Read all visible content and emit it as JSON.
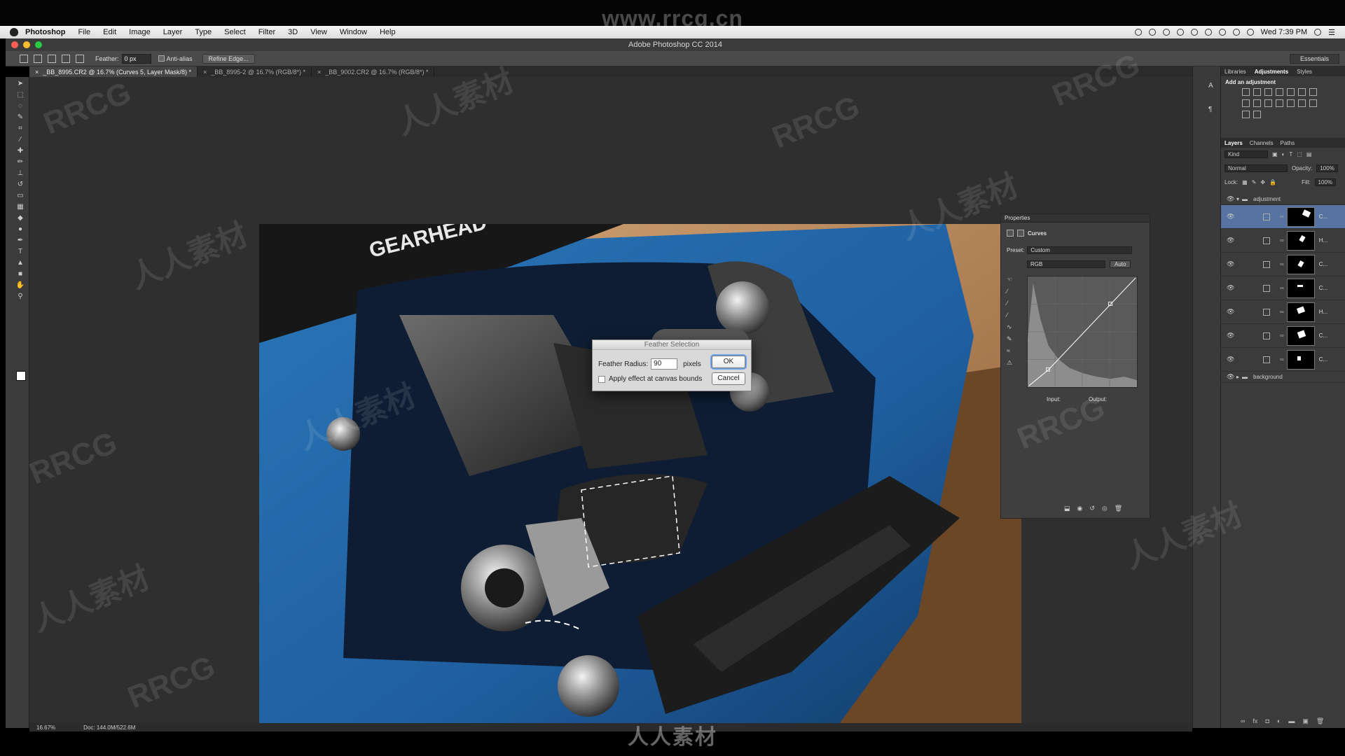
{
  "watermarks": {
    "site_url": "www.rrcg.cn",
    "brand_bottom": "人人素材",
    "tiles": [
      "RRCG",
      "人人素材",
      "RRCG",
      "人人素材",
      "RRCG",
      "人人素材",
      "RRCG",
      "人人素材",
      "RRCG",
      "人人素材",
      "RRCG",
      "人人素材"
    ]
  },
  "menubar": {
    "app_name": "Photoshop",
    "items": [
      "File",
      "Edit",
      "Image",
      "Layer",
      "Type",
      "Select",
      "Filter",
      "3D",
      "View",
      "Window",
      "Help"
    ],
    "clock": "Wed 7:39 PM"
  },
  "window": {
    "title": "Adobe Photoshop CC 2014"
  },
  "options": {
    "feather_label": "Feather:",
    "feather_value": "0 px",
    "antialias_label": "Anti-alias",
    "refine_edge_label": "Refine Edge...",
    "workspace": "Essentials"
  },
  "documents": {
    "tabs": [
      {
        "label": "_BB_8995.CR2 @ 16.7% (Curves 5, Layer Mask/8) *"
      },
      {
        "label": "_BB_8995-2 @ 16.7% (RGB/8*) *"
      },
      {
        "label": "_BB_9002.CR2 @ 16.7% (RGB/8*) *"
      }
    ]
  },
  "photo_text": "GEARHEAD",
  "dialog": {
    "title": "Feather Selection",
    "radius_label": "Feather Radius:",
    "radius_value": "90",
    "unit": "pixels",
    "checkbox_label": "Apply effect at canvas bounds",
    "ok_label": "OK",
    "cancel_label": "Cancel"
  },
  "properties": {
    "panel_title": "Properties",
    "adjustment_name": "Curves",
    "preset_label": "Preset:",
    "preset_value": "Custom",
    "channel_value": "RGB",
    "auto_label": "Auto",
    "input_label": "Input:",
    "output_label": "Output:"
  },
  "right_panel": {
    "top_tabs": [
      "Libraries",
      "Adjustments",
      "Styles"
    ],
    "adjust_title": "Add an adjustment",
    "layer_tabs": [
      "Layers",
      "Channels",
      "Paths"
    ],
    "kind_label": "Kind",
    "blend_mode": "Normal",
    "opacity_label": "Opacity:",
    "opacity_value": "100%",
    "lock_label": "Lock:",
    "fill_label": "Fill:",
    "fill_value": "100%",
    "group_name": "adjustment",
    "layers": [
      {
        "name": "C...",
        "selected": true
      },
      {
        "name": "H...",
        "selected": false
      },
      {
        "name": "C...",
        "selected": false
      },
      {
        "name": "C...",
        "selected": false
      },
      {
        "name": "H...",
        "selected": false
      },
      {
        "name": "C...",
        "selected": false
      },
      {
        "name": "C...",
        "selected": false
      }
    ],
    "background_group": "background"
  },
  "status": {
    "zoom": "16.67%",
    "doc_size": "Doc: 144.0M/522.6M"
  },
  "colors": {
    "ok_focus": "#6fa3e8",
    "selected_layer": "#5673a1",
    "car_blue": "#1f5fa0"
  }
}
